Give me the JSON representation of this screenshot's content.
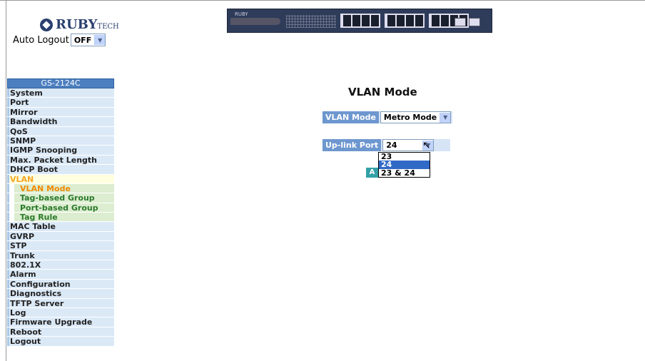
{
  "header": {
    "brand": "RUBY",
    "brand_suffix": "TECH",
    "auto_logout_label": "Auto Logout",
    "auto_logout_value": "OFF",
    "banner_brand": "RUBY"
  },
  "menu": {
    "title": "GS-2124C",
    "items": [
      {
        "label": "System"
      },
      {
        "label": "Port"
      },
      {
        "label": "Mirror"
      },
      {
        "label": "Bandwidth"
      },
      {
        "label": "QoS"
      },
      {
        "label": "SNMP"
      },
      {
        "label": "IGMP Snooping"
      },
      {
        "label": "Max. Packet Length"
      },
      {
        "label": "DHCP Boot"
      },
      {
        "label": "VLAN"
      },
      {
        "label": "VLAN Mode"
      },
      {
        "label": "Tag-based Group"
      },
      {
        "label": "Port-based Group"
      },
      {
        "label": "Tag Rule"
      },
      {
        "label": "MAC Table"
      },
      {
        "label": "GVRP"
      },
      {
        "label": "STP"
      },
      {
        "label": "Trunk"
      },
      {
        "label": "802.1X"
      },
      {
        "label": "Alarm"
      },
      {
        "label": "Configuration"
      },
      {
        "label": "Diagnostics"
      },
      {
        "label": "TFTP Server"
      },
      {
        "label": "Log"
      },
      {
        "label": "Firmware Upgrade"
      },
      {
        "label": "Reboot"
      },
      {
        "label": "Logout"
      }
    ]
  },
  "main": {
    "title": "VLAN Mode",
    "vlan_mode_label": "VLAN Mode",
    "vlan_mode_value": "Metro Mode",
    "uplink_label": "Up-link Port",
    "uplink_value": "24",
    "uplink_options": [
      "23",
      "24",
      "23 & 24"
    ],
    "apply_label": "A"
  },
  "colors": {
    "menu_title": "#4c7fbf",
    "label_bg": "#6e97cf",
    "selected_option": "#3169c6",
    "apply_button": "#34a1a8"
  }
}
